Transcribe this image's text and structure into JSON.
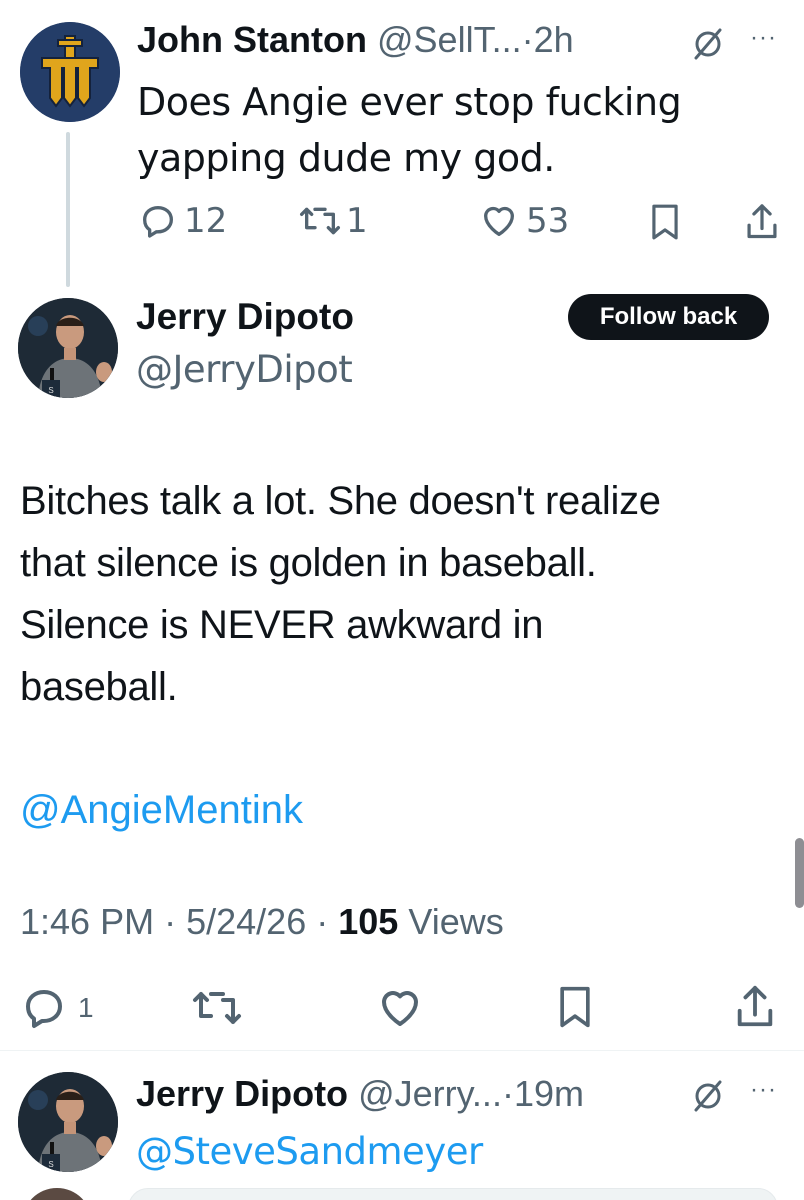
{
  "parent_tweet": {
    "author_name": "John Stanton",
    "handle": "@SellT...",
    "separator": "·",
    "time": "2h",
    "text_line1": "Does Angie ever stop fucking",
    "text_line2": "yapping dude my god.",
    "reply_count": "12",
    "retweet_count": "1",
    "like_count": "53",
    "avatar_icon": "trident-logo-icon"
  },
  "main_tweet": {
    "author_name": "Jerry Dipoto",
    "handle": "@JerryDipot",
    "follow_label": "Follow back",
    "body_line1": "Bitches talk a lot. She doesn't realize",
    "body_line2": "that silence is golden in baseball.",
    "body_line3": "Silence is NEVER awkward in",
    "body_line4": "baseball.",
    "mention": "@AngieMentink",
    "time": "1:46 PM",
    "date": "5/24/26",
    "sep": "·",
    "views_count": "105",
    "views_label": "Views",
    "reply_count": "1"
  },
  "reply_tweet": {
    "author_name": "Jerry Dipoto",
    "handle": "@Jerry...",
    "separator": "·",
    "time": "19m",
    "mention": "@SteveSandmeyer"
  },
  "colors": {
    "link": "#1d9bf0",
    "muted": "#536471",
    "text": "#0f1419",
    "button": "#0f1419",
    "mariners_navy": "#1f3a63",
    "mariners_gold": "#d9a21b"
  }
}
